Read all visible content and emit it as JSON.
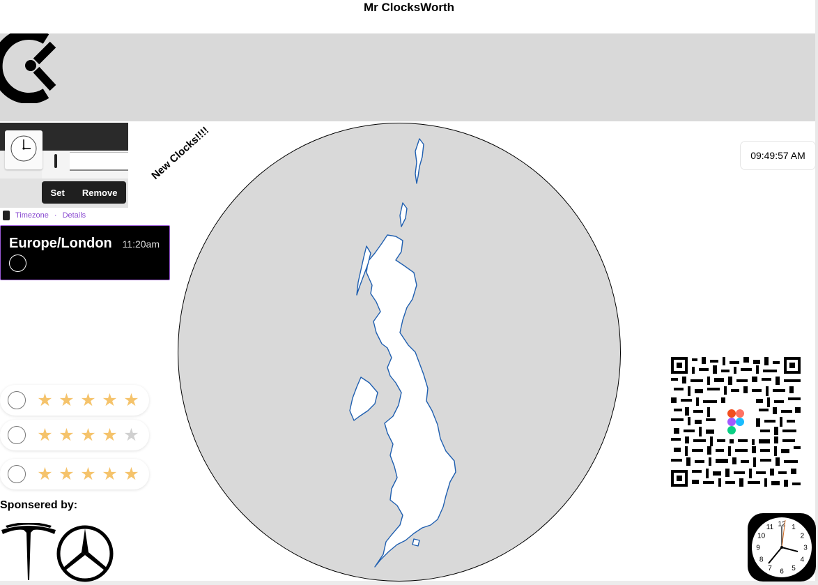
{
  "header": {
    "title": "Mr ClocksWorth"
  },
  "product_card": {
    "set_label": "Set",
    "remove_label": "Remove",
    "timezone_link": "Timezone",
    "separator": "·",
    "details_link": "Details"
  },
  "timezone_card": {
    "zone": "Europe/London",
    "time": "11:20am"
  },
  "promo": {
    "text": "New Clocks!!!!"
  },
  "time_pill": {
    "time": "09:49:57 AM"
  },
  "ratings": [
    {
      "stars": 5,
      "max": 5
    },
    {
      "stars": 4,
      "max": 5
    },
    {
      "stars": 5,
      "max": 5
    }
  ],
  "sponsors": {
    "label": "Sponsered by:",
    "logos": [
      "tesla-logo",
      "mercedes-logo"
    ]
  },
  "clock_app": {
    "numbers": [
      "12",
      "1",
      "2",
      "3",
      "4",
      "5",
      "6",
      "7",
      "8",
      "9",
      "10",
      "11"
    ]
  },
  "colors": {
    "accent": "#9b59d6",
    "star": "#f5c36b",
    "star_off": "#d0d0d0",
    "banner": "#d9d9d9",
    "map_outline": "#1f5fb0"
  },
  "icons": [
    "clockify-logo",
    "watch-icon",
    "figma-icon",
    "clock-app-icon"
  ]
}
